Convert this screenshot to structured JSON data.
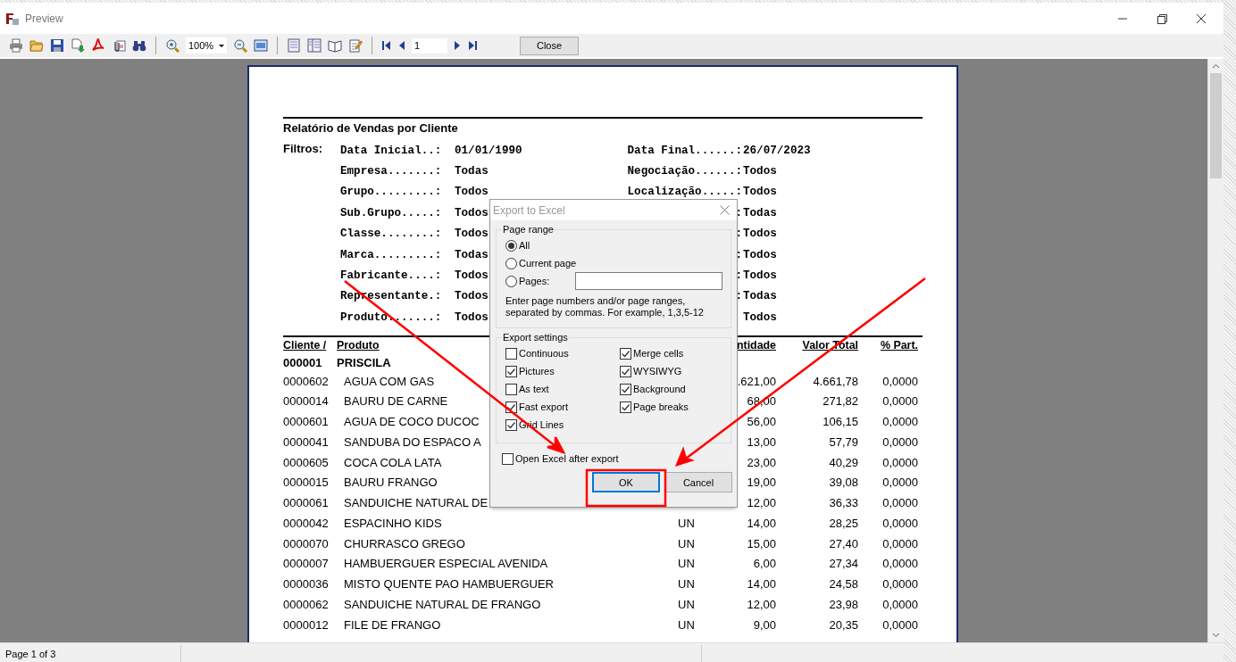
{
  "window": {
    "title": "Preview"
  },
  "toolbar": {
    "zoom": "100%",
    "page": "1",
    "close_button": "Close"
  },
  "report": {
    "title": "Relatório de Vendas por Cliente",
    "filters_label": "Filtros:",
    "filters": [
      {
        "left": {
          "label": "Data Inicial..:",
          "value": "01/01/1990"
        },
        "right": {
          "label": "Data Final......:",
          "value": "26/07/2023"
        }
      },
      {
        "left": {
          "label": "Empresa.......:",
          "value": "Todas"
        },
        "right": {
          "label": "Negociação......:",
          "value": "Todos"
        }
      },
      {
        "left": {
          "label": "Grupo.........:",
          "value": "Todos"
        },
        "right": {
          "label": "Localização.....:",
          "value": "Todos"
        }
      },
      {
        "left": {
          "label": "Sub.Grupo.....:",
          "value": "Todos"
        },
        "right": {
          "label": ":",
          "value": "Todas"
        }
      },
      {
        "left": {
          "label": "Classe........:",
          "value": "Todos"
        },
        "right": {
          "label": ":",
          "value": "Todos"
        }
      },
      {
        "left": {
          "label": "Marca.........:",
          "value": "Todas"
        },
        "right": {
          "label": ":",
          "value": "Todos"
        }
      },
      {
        "left": {
          "label": "Fabricante....:",
          "value": "Todos"
        },
        "right": {
          "label": ":",
          "value": "Todos"
        }
      },
      {
        "left": {
          "label": "Representante.:",
          "value": "Todos"
        },
        "right": {
          "label": ":",
          "value": "Todas"
        }
      },
      {
        "left": {
          "label": "Produto.......:",
          "value": "Todos"
        },
        "right": {
          "value": "Todos"
        }
      }
    ],
    "columns": [
      "Cliente /",
      "Produto",
      "ntidade",
      "Valor Total",
      "% Part."
    ],
    "client": {
      "code": "000001",
      "name": "PRISCILA"
    },
    "rows": [
      {
        "code": "0000602",
        "product": "AGUA COM GAS",
        "quantity": ".621,00",
        "total": "4.661,78",
        "share": "0,0000"
      },
      {
        "code": "0000014",
        "product": "BAURU DE CARNE",
        "quantity": "68,00",
        "total": "271,82",
        "share": "0,0000"
      },
      {
        "code": "0000601",
        "product": "AGUA DE COCO DUCOC",
        "quantity": "56,00",
        "total": "106,15",
        "share": "0,0000"
      },
      {
        "code": "0000041",
        "product": "SANDUBA DO ESPACO A",
        "quantity": "13,00",
        "total": "57,79",
        "share": "0,0000"
      },
      {
        "code": "0000605",
        "product": "COCA COLA LATA",
        "quantity": "23,00",
        "total": "40,29",
        "share": "0,0000"
      },
      {
        "code": "0000015",
        "product": "BAURU FRANGO",
        "quantity": "19,00",
        "total": "39,08",
        "share": "0,0000"
      },
      {
        "code": "0000061",
        "product": "SANDUICHE NATURAL DE",
        "quantity": "12,00",
        "total": "36,33",
        "share": "0,0000"
      },
      {
        "code": "0000042",
        "product": "ESPACINHO KIDS",
        "unit": "UN",
        "quantity": "14,00",
        "total": "28,25",
        "share": "0,0000"
      },
      {
        "code": "0000070",
        "product": "CHURRASCO GREGO",
        "unit": "UN",
        "quantity": "15,00",
        "total": "27,40",
        "share": "0,0000"
      },
      {
        "code": "0000007",
        "product": "HAMBUERGUER ESPECIAL AVENIDA",
        "unit": "UN",
        "quantity": "6,00",
        "total": "27,34",
        "share": "0,0000"
      },
      {
        "code": "0000036",
        "product": "MISTO QUENTE PAO HAMBUERGUER",
        "unit": "UN",
        "quantity": "14,00",
        "total": "24,58",
        "share": "0,0000"
      },
      {
        "code": "0000062",
        "product": "SANDUICHE NATURAL DE FRANGO",
        "unit": "UN",
        "quantity": "12,00",
        "total": "23,98",
        "share": "0,0000"
      },
      {
        "code": "0000012",
        "product": "FILE DE FRANGO",
        "unit": "UN",
        "quantity": "9,00",
        "total": "20,35",
        "share": "0,0000"
      }
    ]
  },
  "dialog": {
    "title": "Export to Excel",
    "page_range": {
      "title": "Page range",
      "options": [
        {
          "label": "All",
          "selected": true
        },
        {
          "label": "Current page",
          "selected": false
        },
        {
          "label": "Pages:",
          "selected": false
        }
      ],
      "hint": "Enter page numbers and/or page ranges, separated by commas. For example, 1,3,5-12"
    },
    "export_settings": {
      "title": "Export settings",
      "options": [
        {
          "label": "Continuous",
          "checked": false
        },
        {
          "label": "Merge cells",
          "checked": true
        },
        {
          "label": "Pictures",
          "checked": true
        },
        {
          "label": "WYSIWYG",
          "checked": true
        },
        {
          "label": "As text",
          "checked": false
        },
        {
          "label": "Background",
          "checked": true
        },
        {
          "label": "Fast export",
          "checked": true
        },
        {
          "label": "Page breaks",
          "checked": true
        },
        {
          "label": "Grid Lines",
          "checked": true
        }
      ]
    },
    "open_after": {
      "label": "Open Excel after export",
      "checked": false
    },
    "buttons": [
      {
        "label": "OK",
        "default": true
      },
      {
        "label": "Cancel",
        "default": false
      }
    ]
  },
  "status_bar": {
    "text": "Page 1 of 3"
  }
}
